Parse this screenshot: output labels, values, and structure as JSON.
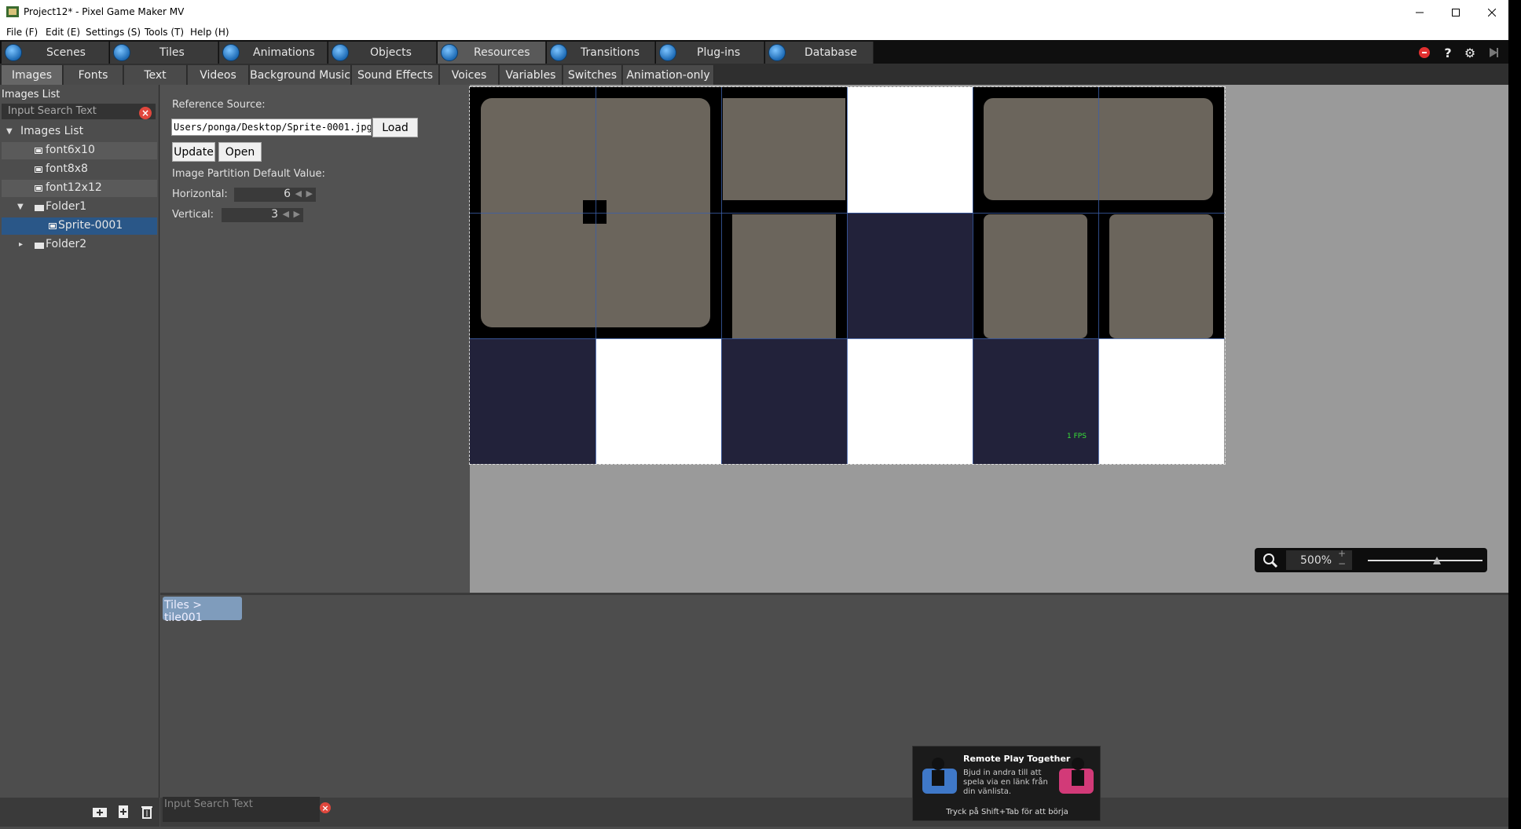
{
  "window": {
    "title": "Project12* - Pixel Game Maker MV"
  },
  "menu": [
    "File (F)",
    "Edit (E)",
    "Settings (S)",
    "Tools (T)",
    "Help (H)"
  ],
  "tabs": [
    "Scenes",
    "Tiles",
    "Animations",
    "Objects",
    "Resources",
    "Transitions",
    "Plug-ins",
    "Database"
  ],
  "active_tab": "Resources",
  "subtabs": [
    "Images",
    "Fonts",
    "Text",
    "Videos",
    "Background Music",
    "Sound Effects",
    "Voices",
    "Variables",
    "Switches",
    "Animation-only"
  ],
  "active_subtab": "Images",
  "images_list": {
    "header": "Images List",
    "search_placeholder": "Input Search Text",
    "root": "Images List",
    "items": [
      "font6x10",
      "font8x8",
      "font12x12",
      "Folder1",
      "Sprite-0001",
      "Folder2"
    ],
    "selected": "Sprite-0001"
  },
  "props": {
    "reference_source_label": "Reference Source:",
    "reference_source_value": "Users/ponga/Desktop/Sprite-0001.jpg",
    "load": "Load",
    "update": "Update",
    "open": "Open",
    "partition_label": "Image Partition Default Value:",
    "horizontal_label": "Horizontal:",
    "horizontal_value": "6",
    "vertical_label": "Vertical:",
    "vertical_value": "3"
  },
  "canvas": {
    "fps_label": "1 FPS",
    "zoom": "500%"
  },
  "lower": {
    "breadcrumb": "Tiles > tile001",
    "search_placeholder": "Input Search Text"
  },
  "remote_play": {
    "title": "Remote Play Together",
    "body": "Bjud in andra till att spela via en länk från din vänlista.",
    "footer": "Tryck på Shift+Tab för att börja"
  },
  "colors": {
    "accent": "#2a5788",
    "navy": "#22223a",
    "tile_gray": "#6b655c",
    "fps_green": "#38e038"
  }
}
